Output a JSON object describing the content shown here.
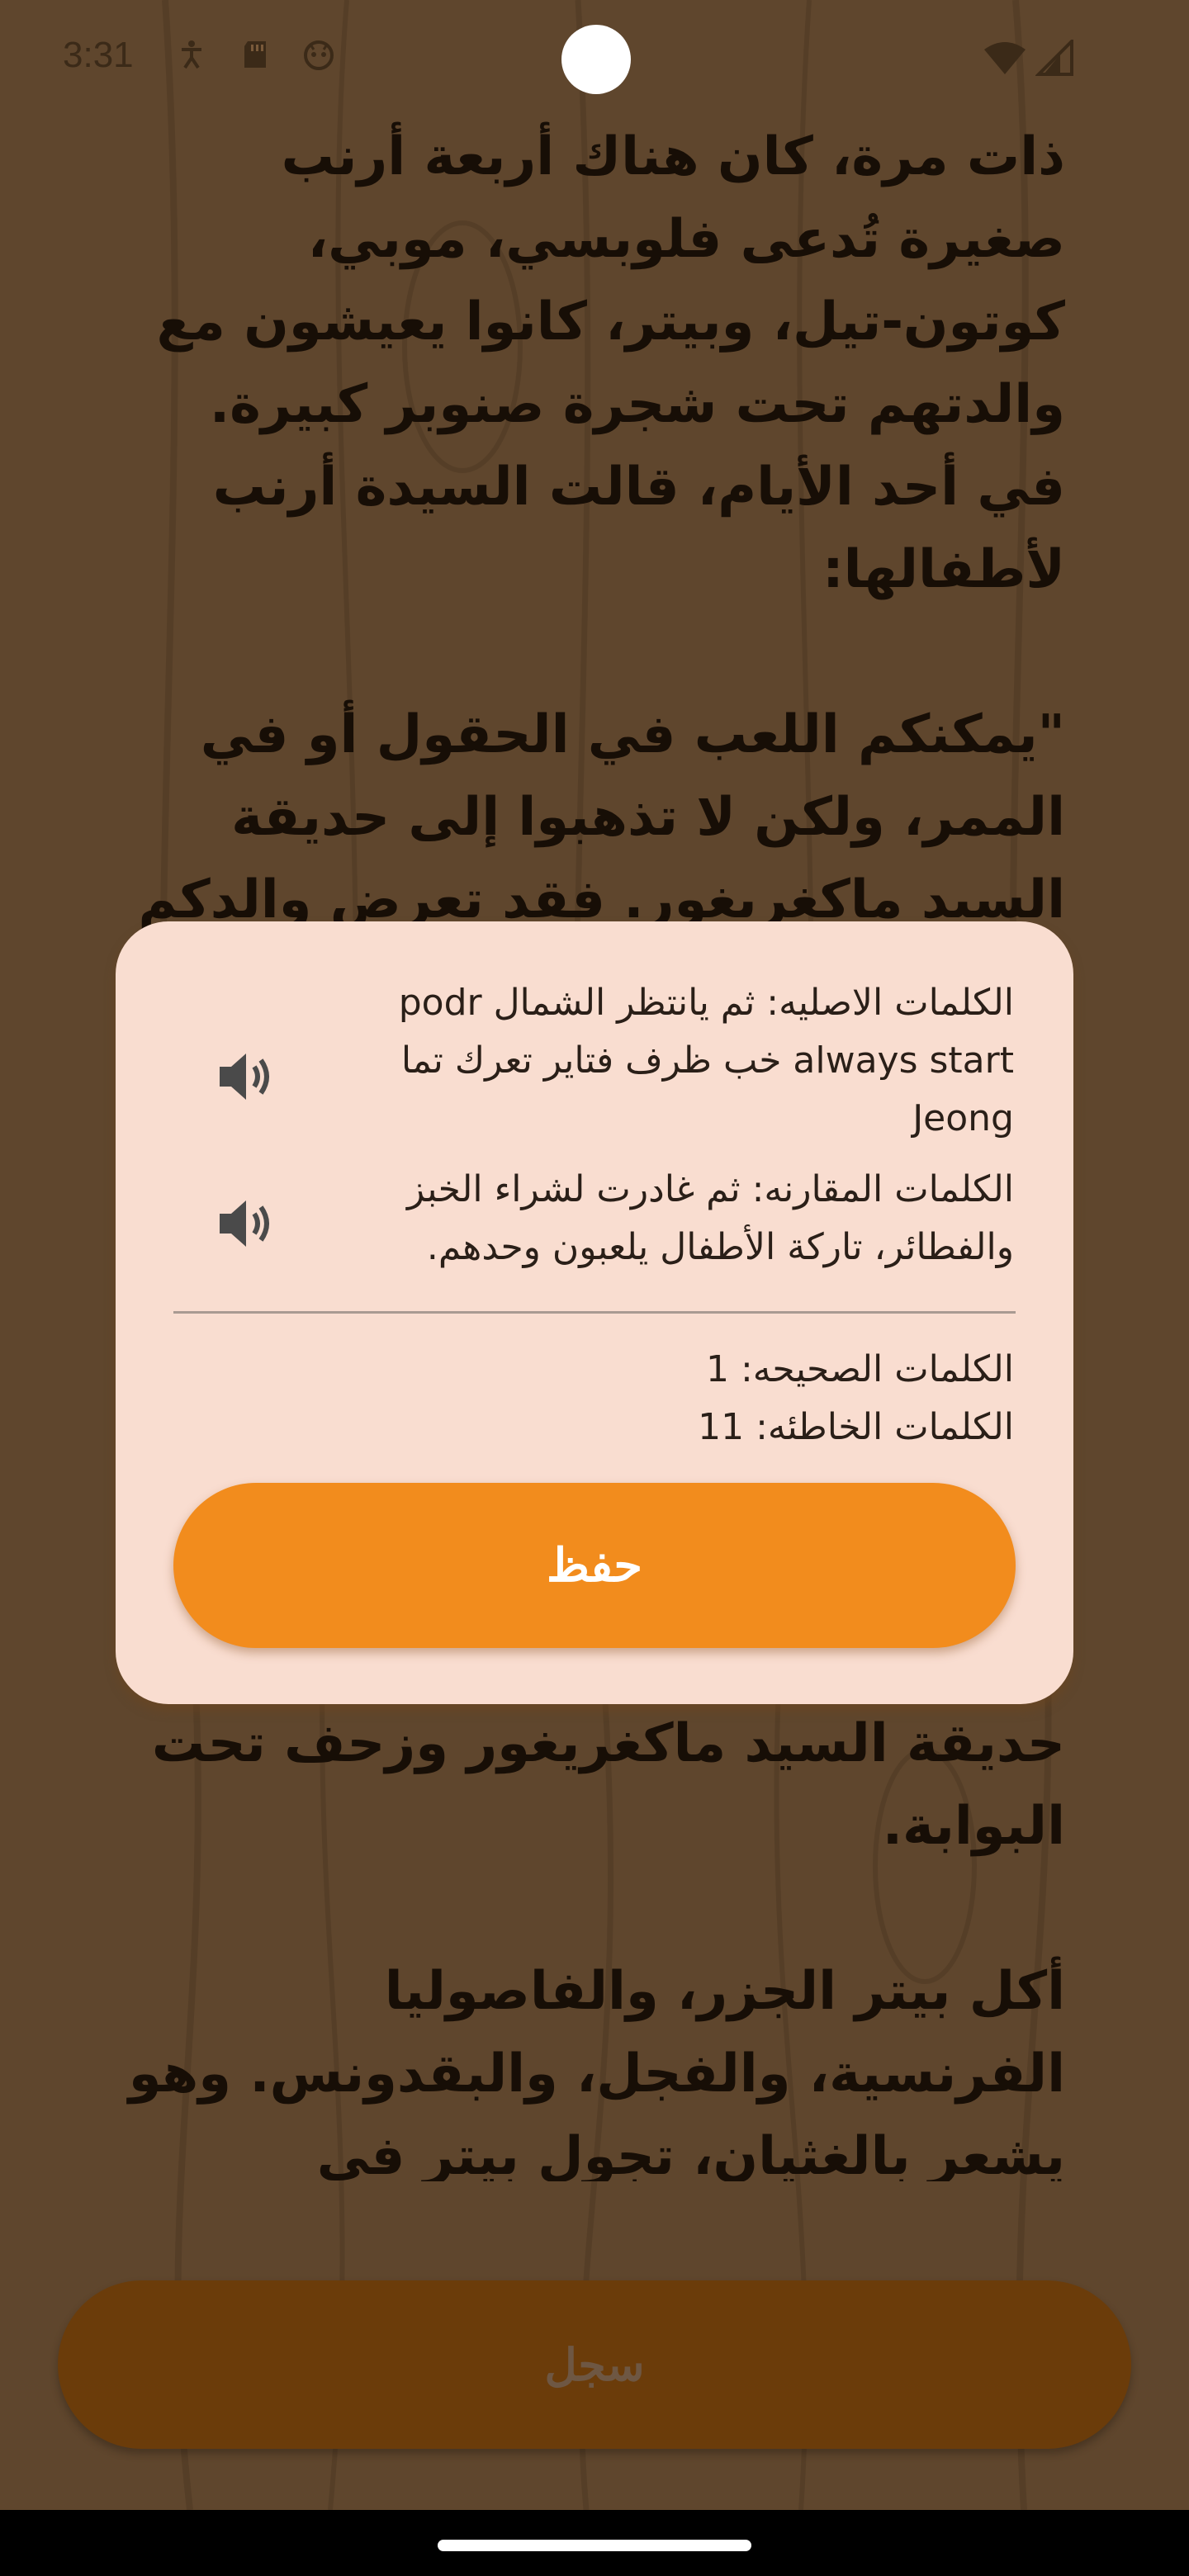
{
  "status_bar": {
    "time": "3:31",
    "icons": [
      "accessibility-icon",
      "sd-card-icon",
      "app-notification-icon",
      "wifi-icon",
      "cell-signal-icon"
    ]
  },
  "story": {
    "paragraph_top": "ذات مرة، كان هناك أربعة أرنب صغيرة تُدعى فلوبسي، موبي، كوتون-تيل، وبيتر، كانوا يعيشون مع والدتهم تحت شجرة صنوبر كبيرة. في أحد الأيام، قالت السيدة أرنب لأطفالها:\n\n\"يمكنكم اللعب في الحقول أو في الممر، ولكن لا تذهبوا إلى حديقة السيد ماكغريغور. فقد تعرض والدكم لحادث هناك، ووُضع في فطيرة من قبل السيدة",
    "paragraph_bottom": "حديقة السيد ماكغريغور وزحف تحت البوابة.\n\nأكل بيتر الجزر، والفاصوليا الفرنسية، والفجل، والبقدونس. وهو يشعر بالغثيان، تجول بيتر في الحديقة بحثاً"
  },
  "dialog": {
    "original_words": "الكلمات الاصليه: ثم يانتظر الشمال podr always start خب ظرف فتاير تعرك تما Jeong",
    "compared_words": "الكلمات المقارنه: ثم غادرت لشراء الخبز والفطائر، تاركة الأطفال يلعبون وحدهم.",
    "correct_words": "الكلمات الصحيحه: 1",
    "wrong_words": "الكلمات الخاطئه: 11",
    "save_label": "حفظ"
  },
  "record_button": {
    "label": "سجل"
  },
  "colors": {
    "background": "#7a5a3a",
    "dialog": "#f9ddd0",
    "save_button": "#f28c1d",
    "record_button": "#8a4e0e"
  }
}
